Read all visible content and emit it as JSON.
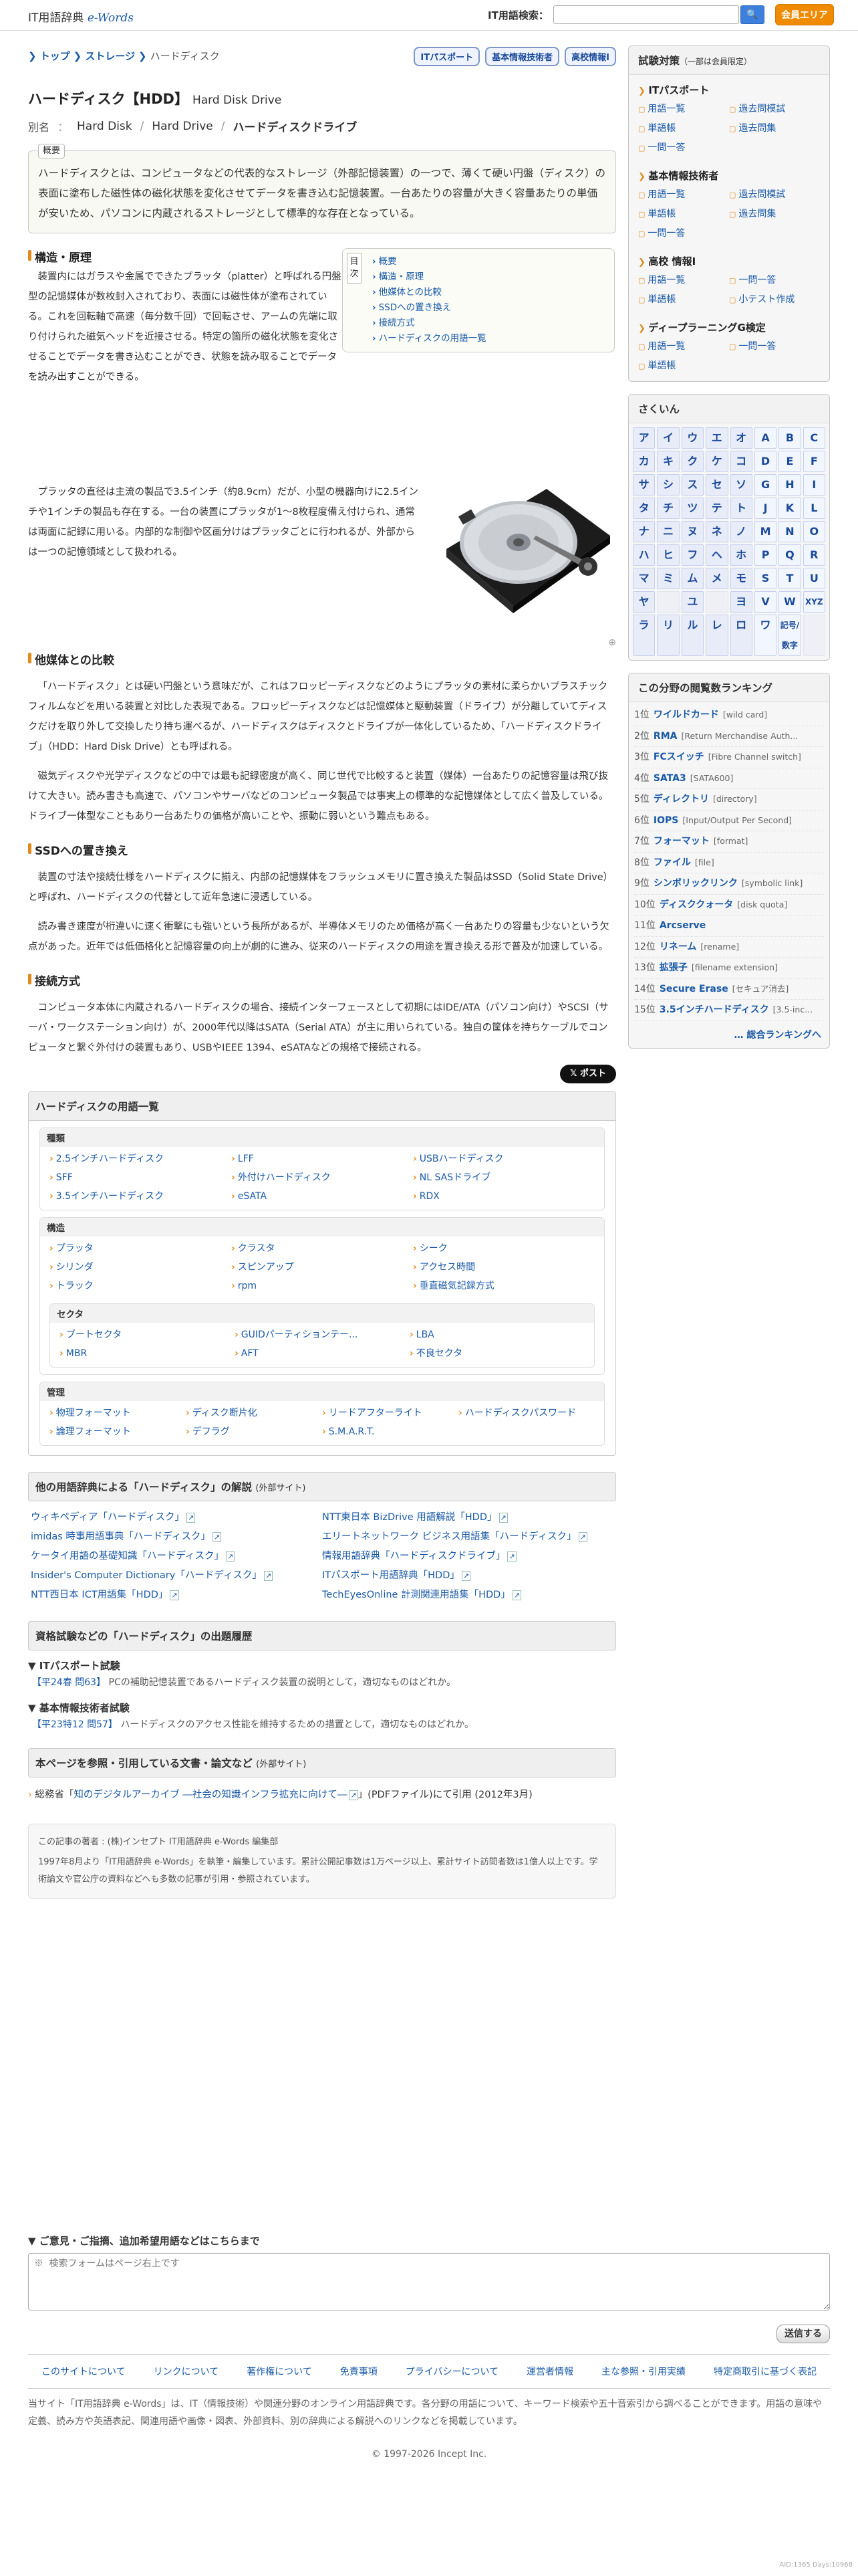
{
  "header": {
    "logo_text": "IT用語辞典",
    "logo_ew": "e-Words",
    "search_label": "IT用語検索：",
    "search_value": "",
    "search_button": "🔍",
    "member_button": "会員エリア"
  },
  "breadcrumb": [
    "トップ",
    "ストレージ",
    "ハードディスク"
  ],
  "exam_tabs": [
    "ITパスポート",
    "基本情報技術者",
    "高校情報Ⅰ"
  ],
  "title": {
    "main": "ハードディスク【HDD】",
    "en": "Hard Disk Drive"
  },
  "alias": {
    "label": "別名",
    "items": [
      "Hard Disk",
      "Hard Drive",
      "ハードディスクドライブ"
    ]
  },
  "summary": {
    "tag": "概要",
    "text": "ハードディスクとは、コンピュータなどの代表的なストレージ（外部記憶装置）の一つで、薄くて硬い円盤（ディスク）の表面に塗布した磁性体の磁化状態を変化させてデータを書き込む記憶装置。一台あたりの容量が大きく容量あたりの単価が安いため、パソコンに内蔵されるストレージとして標準的な存在となっている。"
  },
  "toc": {
    "title": "目次",
    "items": [
      "概要",
      "構造・原理",
      "他媒体との比較",
      "SSDへの置き換え",
      "接続方式",
      "ハードディスクの用語一覧"
    ]
  },
  "sections": [
    {
      "heading": "構造・原理",
      "paragraphs": [
        "装置内にはガラスや金属でできたプラッタ（platter）と呼ばれる円盤型の記憶媒体が数枚封入されており、表面には磁性体が塗布されている。これを回転軸で高速（毎分数千回）で回転させ、アームの先端に取り付けられた磁気ヘッドを近接させる。特定の箇所の磁化状態を変化させることでデータを書き込むことができ、状態を読み取ることでデータを読み出すことができる。",
        "プラッタの直径は主流の製品で3.5インチ（約8.9cm）だが、小型の機器向けに2.5インチや1インチの製品も存在する。一台の装置にプラッタが1～8枚程度備え付けられ、通常は両面に記録に用いる。内部的な制御や区画分けはプラッタごとに行われるが、外部からは一つの記憶領域として扱われる。"
      ]
    },
    {
      "heading": "他媒体との比較",
      "paragraphs": [
        "「ハードディスク」とは硬い円盤という意味だが、これはフロッピーディスクなどのようにプラッタの素材に柔らかいプラスチックフィルムなどを用いる装置と対比した表現である。フロッピーディスクなどは記憶媒体と駆動装置（ドライブ）が分離していてディスクだけを取り外して交換したり持ち運べるが、ハードディスクはディスクとドライブが一体化しているため、「ハードディスクドライブ」（HDD：Hard Disk Drive）とも呼ばれる。",
        "磁気ディスクや光学ディスクなどの中では最も記録密度が高く、同じ世代で比較すると装置（媒体）一台あたりの記憶容量は飛び抜けて大きい。読み書きも高速で、パソコンやサーバなどのコンピュータ製品では事実上の標準的な記憶媒体として広く普及している。ドライブ一体型なこともあり一台あたりの価格が高いことや、振動に弱いという難点もある。"
      ]
    },
    {
      "heading": "SSDへの置き換え",
      "paragraphs": [
        "装置の寸法や接続仕様をハードディスクに揃え、内部の記憶媒体をフラッシュメモリに置き換えた製品はSSD（Solid State Drive）と呼ばれ、ハードディスクの代替として近年急速に浸透している。",
        "読み書き速度が桁違いに速く衝撃にも強いという長所があるが、半導体メモリのため価格が高く一台あたりの容量も少ないという欠点があった。近年では低価格化と記憶容量の向上が劇的に進み、従来のハードディスクの用途を置き換える形で普及が加速している。"
      ]
    },
    {
      "heading": "接続方式",
      "paragraphs": [
        "コンピュータ本体に内蔵されるハードディスクの場合、接続インターフェースとして初期にはIDE/ATA（パソコン向け）やSCSI（サーバ・ワークステーション向け）が、2000年代以降はSATA（Serial ATA）が主に用いられている。独自の筐体を持ちケーブルでコンピュータと繋ぐ外付けの装置もあり、USBやIEEE 1394、eSATAなどの規格で接続される。"
      ]
    }
  ],
  "share_button": "𝕏 ポスト",
  "term_list": {
    "heading": "ハードディスクの用語一覧",
    "groups": [
      {
        "title": "種類",
        "items": [
          "2.5インチハードディスク",
          "LFF",
          "USBハードディスク",
          "SFF",
          "外付けハードディスク",
          "NL SASドライブ",
          "3.5インチハードディスク",
          "eSATA",
          "RDX"
        ]
      },
      {
        "title": "構造",
        "items": [
          "プラッタ",
          "クラスタ",
          "シーク",
          "シリンダ",
          "スピンアップ",
          "アクセス時間",
          "トラック",
          "rpm",
          "垂直磁気記録方式"
        ]
      },
      {
        "title": "セクタ",
        "items": [
          "ブートセクタ",
          "GUIDパーティションテー...",
          "LBA",
          "MBR",
          "AFT",
          "不良セクタ"
        ]
      },
      {
        "title": "管理",
        "items": [
          "物理フォーマット",
          "ディスク断片化",
          "リードアフターライト",
          "ハードディスクパスワード",
          "論理フォーマット",
          "デフラグ",
          "S.M.A.R.T."
        ]
      }
    ]
  },
  "other_dicts": {
    "heading": "他の用語辞典による「ハードディスク」の解説",
    "sub": "(外部サイト)",
    "items": [
      "ウィキペディア「ハードディスク」",
      "NTT東日本 BizDrive 用語解説「HDD」",
      "imidas 時事用語事典「ハードディスク」",
      "エリートネットワーク ビジネス用語集「ハードディスク」",
      "ケータイ用語の基礎知識「ハードディスク」",
      "情報用語辞典「ハードディスクドライブ」",
      "Insider's Computer Dictionary「ハードディスク」",
      "ITパスポート用語辞典「HDD」",
      "NTT西日本 ICT用語集「HDD」",
      "TechEyesOnline 計測関連用語集「HDD」"
    ]
  },
  "exam_history": {
    "heading": "資格試験などの「ハードディスク」の出題履歴",
    "blocks": [
      {
        "exam": "▼ ITパスポート試験",
        "ref": "【平24春 問63】",
        "text": "PCの補助記憶装置であるハードディスク装置の説明として，適切なものはどれか。"
      },
      {
        "exam": "▼ 基本情報技術者試験",
        "ref": "【平23特12 問57】",
        "text": "ハードディスクのアクセス性能を維持するための措置として，適切なものはどれか。"
      }
    ]
  },
  "references": {
    "heading": "本ページを参照・引用している文書・論文など",
    "sub": "(外部サイト)",
    "prefix": "総務省「",
    "title": "知のデジタルアーカイブ ―社会の知識インフラ拡充に向けて―",
    "suffix": "」(PDFファイル)にて引用 (2012年3月)"
  },
  "author": {
    "line1": "この記事の著者 : (株)インセプト IT用語辞典 e-Words 編集部",
    "line2": "1997年8月より「IT用語辞典 e-Words」を執筆・編集しています。累計公開記事数は1万ページ以上、累計サイト訪問者数は1億人以上です。学術論文や官公庁の資料などへも多数の記事が引用・参照されています。"
  },
  "sidebar": {
    "exam_box": {
      "heading": "試験対策",
      "sub": "（一部は会員限定）",
      "groups": [
        {
          "title": "ITパスポート",
          "links": [
            "用語一覧",
            "過去問模試",
            "単語帳",
            "過去問集",
            "一問一答"
          ]
        },
        {
          "title": "基本情報技術者",
          "links": [
            "用語一覧",
            "過去問模試",
            "単語帳",
            "過去問集",
            "一問一答"
          ]
        },
        {
          "title": "高校 情報Ⅰ",
          "links": [
            "用語一覧",
            "一問一答",
            "単語帳",
            "小テスト作成"
          ]
        },
        {
          "title": "ディープラーニングG検定",
          "links": [
            "用語一覧",
            "一問一答",
            "単語帳"
          ]
        }
      ]
    },
    "kana": {
      "heading": "さくいん",
      "cells": [
        "ア",
        "イ",
        "ウ",
        "エ",
        "オ",
        "A",
        "B",
        "C",
        "カ",
        "キ",
        "ク",
        "ケ",
        "コ",
        "D",
        "E",
        "F",
        "サ",
        "シ",
        "ス",
        "セ",
        "ソ",
        "G",
        "H",
        "I",
        "タ",
        "チ",
        "ツ",
        "テ",
        "ト",
        "J",
        "K",
        "L",
        "ナ",
        "ニ",
        "ヌ",
        "ネ",
        "ノ",
        "M",
        "N",
        "O",
        "ハ",
        "ヒ",
        "フ",
        "ヘ",
        "ホ",
        "P",
        "Q",
        "R",
        "マ",
        "ミ",
        "ム",
        "メ",
        "モ",
        "S",
        "T",
        "U",
        "ヤ",
        "",
        "ユ",
        "",
        "ヨ",
        "V",
        "W",
        "XYZ",
        "ラ",
        "リ",
        "ル",
        "レ",
        "ロ",
        "ワ",
        "記号/数字",
        ""
      ]
    },
    "ranking": {
      "heading": "この分野の閲覧数ランキング",
      "items": [
        {
          "n": "1位",
          "t": "ワイルドカード",
          "e": "[wild card]"
        },
        {
          "n": "2位",
          "t": "RMA",
          "e": "[Return Merchandise Auth..."
        },
        {
          "n": "3位",
          "t": "FCスイッチ",
          "e": "[Fibre Channel switch]"
        },
        {
          "n": "4位",
          "t": "SATA3",
          "e": "[SATA600]"
        },
        {
          "n": "5位",
          "t": "ディレクトリ",
          "e": "[directory]"
        },
        {
          "n": "6位",
          "t": "IOPS",
          "e": "[Input/Output Per Second]"
        },
        {
          "n": "7位",
          "t": "フォーマット",
          "e": "[format]"
        },
        {
          "n": "8位",
          "t": "ファイル",
          "e": "[file]"
        },
        {
          "n": "9位",
          "t": "シンボリックリンク",
          "e": "[symbolic link]"
        },
        {
          "n": "10位",
          "t": "ディスククォータ",
          "e": "[disk quota]"
        },
        {
          "n": "11位",
          "t": "Arcserve",
          "e": ""
        },
        {
          "n": "12位",
          "t": "リネーム",
          "e": "[rename]"
        },
        {
          "n": "13位",
          "t": "拡張子",
          "e": "[filename extension]"
        },
        {
          "n": "14位",
          "t": "Secure Erase",
          "e": "[セキュア消去]"
        },
        {
          "n": "15位",
          "t": "3.5インチハードディスク",
          "e": "[3.5-inc..."
        }
      ],
      "more": "… 総合ランキングへ"
    }
  },
  "feedback": {
    "heading": "▼ ご意見・ご指摘、追加希望用語などはこちらまで",
    "placeholder": "※ 検索フォームはページ右上です",
    "button": "送信する"
  },
  "footer": {
    "links": [
      "このサイトについて",
      "リンクについて",
      "著作権について",
      "免責事項",
      "プライバシーについて",
      "運営者情報",
      "主な参照・引用実績",
      "特定商取引に基づく表記"
    ],
    "desc": "当サイト「IT用語辞典 e-Words」は、IT（情報技術）や関連分野のオンライン用語辞典です。各分野の用語について、キーワード検索や五十音索引から調べることができます。用語の意味や定義、読み方や英語表記、関連用語や画像・図表、外部資料、別の辞典による解説へのリンクなどを掲載しています。",
    "copyright": "© 1997-2026 Incept Inc.",
    "corner": "AID:1365 Days:10968"
  }
}
